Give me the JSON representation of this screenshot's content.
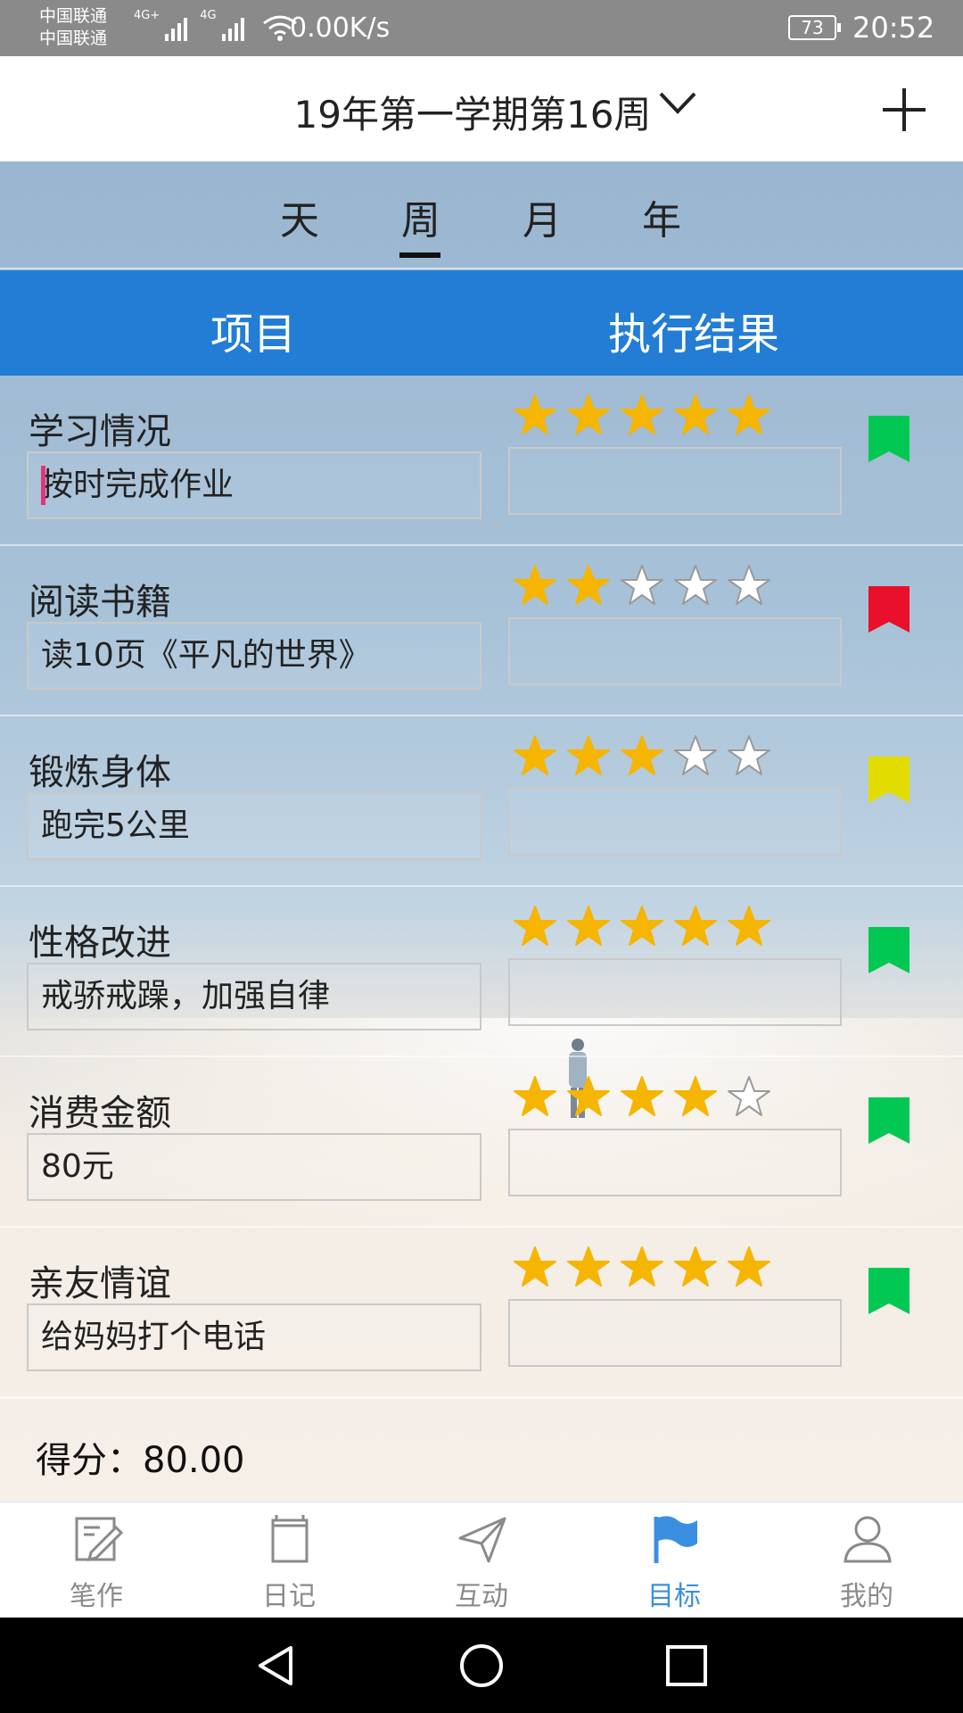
{
  "status_bar": {
    "carrier_1": "中国联通",
    "carrier_2": "中国联通",
    "net_1": "4G+",
    "net_2": "4G",
    "speed": "0.00K/s",
    "battery": "73",
    "time": "20:52"
  },
  "header": {
    "title": "19年第一学期第16周",
    "dropdown_icon": "chevron-down-icon",
    "add_icon": "plus-icon"
  },
  "period_tabs": {
    "items": [
      "天",
      "周",
      "月",
      "年"
    ],
    "active": "周"
  },
  "table_header": {
    "col_item": "项目",
    "col_result": "执行结果"
  },
  "goals": [
    {
      "title": "学习情况",
      "detail": "按时完成作业",
      "rating": 5,
      "result": "",
      "flag_color": "#00c853"
    },
    {
      "title": "阅读书籍",
      "detail": "读10页《平凡的世界》",
      "rating": 2,
      "result": "",
      "flag_color": "#e8102a"
    },
    {
      "title": "锻炼身体",
      "detail": "跑完5公里",
      "rating": 3,
      "result": "",
      "flag_color": "#e2dc00"
    },
    {
      "title": "性格改进",
      "detail": "戒骄戒躁，加强自律",
      "rating": 5,
      "result": "",
      "flag_color": "#00c853"
    },
    {
      "title": "消费金额",
      "detail": "80元",
      "rating": 4,
      "result": "",
      "flag_color": "#00c853"
    },
    {
      "title": "亲友情谊",
      "detail": "给妈妈打个电话",
      "rating": 5,
      "result": "",
      "flag_color": "#00c853"
    }
  ],
  "score": "得分：80.00",
  "bottom_nav": {
    "items": [
      {
        "label": "笔作",
        "icon": "pen-note-icon"
      },
      {
        "label": "日记",
        "icon": "diary-book-icon"
      },
      {
        "label": "互动",
        "icon": "paper-plane-icon"
      },
      {
        "label": "目标",
        "icon": "flag-icon"
      },
      {
        "label": "我的",
        "icon": "person-icon"
      }
    ],
    "active": "目标"
  },
  "colors": {
    "accent_blue": "#237dd4",
    "star_filled": "#f5b500",
    "nav_active": "#3b8fe0"
  }
}
